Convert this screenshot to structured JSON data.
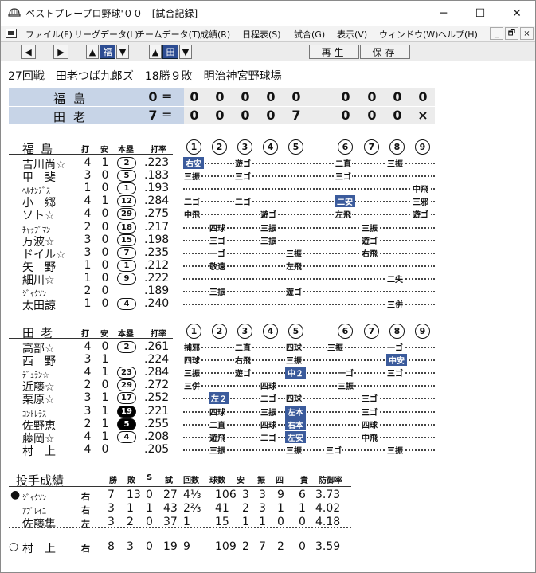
{
  "window": {
    "title": "ベストプレープロ野球'００ - [試合記録]",
    "min": "─",
    "max": "☐",
    "close": "✕"
  },
  "menu": [
    "ファイル(F)",
    "リーグデータ(L)",
    "チームデータ(T)",
    "成績(R)",
    "日程表(S)",
    "試合(G)",
    "表示(V)",
    "ウィンドウ(W)",
    "ヘルプ(H)"
  ],
  "mdi": {
    "min": "_",
    "restore": "🗗",
    "close": "×"
  },
  "toolbar": {
    "team1": "福",
    "team2": "田",
    "play": "再生",
    "save": "保存"
  },
  "game": {
    "info": "27回戦　田老つば九郎ズ　18勝９敗　明治神宮野球場"
  },
  "scoreboard": [
    {
      "team": "福島",
      "runs": "0",
      "eq": "=",
      "inn": [
        "0",
        "0",
        "0",
        "0",
        "0",
        "0",
        "0",
        "0",
        "0"
      ]
    },
    {
      "team": "田老",
      "runs": "7",
      "eq": "=",
      "inn": [
        "0",
        "0",
        "0",
        "0",
        "7",
        "0",
        "0",
        "0",
        "×"
      ]
    }
  ],
  "col_headers": {
    "ab": "打",
    "h": "安",
    "hr": "本塁",
    "avg": "打率"
  },
  "innings": [
    "1",
    "2",
    "3",
    "4",
    "5",
    "6",
    "7",
    "8",
    "9"
  ],
  "away": {
    "team": "福島",
    "players": [
      {
        "name": "吉川尚☆",
        "ab": "4",
        "h": "1",
        "hr": "2",
        "avg": ".223"
      },
      {
        "name": "甲　斐",
        "ab": "3",
        "h": "0",
        "hr": "5",
        "avg": ".183"
      },
      {
        "name": "ﾍﾙﾅﾝﾃﾞｽ",
        "ab": "1",
        "h": "0",
        "hr": "1",
        "avg": ".193"
      },
      {
        "name": "小　郷",
        "ab": "4",
        "h": "1",
        "hr": "12",
        "avg": ".284"
      },
      {
        "name": "ソト☆",
        "ab": "4",
        "h": "0",
        "hr": "29",
        "avg": ".275"
      },
      {
        "name": "ﾁｬｯﾌﾟﾏﾝ",
        "ab": "2",
        "h": "0",
        "hr": "18",
        "avg": ".217"
      },
      {
        "name": "万波☆",
        "ab": "3",
        "h": "0",
        "hr": "15",
        "avg": ".198"
      },
      {
        "name": "ドイル☆",
        "ab": "3",
        "h": "0",
        "hr": "7",
        "avg": ".235"
      },
      {
        "name": "矢　野",
        "ab": "1",
        "h": "0",
        "hr": "1",
        "avg": ".212"
      },
      {
        "name": "細川☆",
        "ab": "1",
        "h": "0",
        "hr": "9",
        "avg": ".222"
      },
      {
        "name": "ｼﾞｬｸｿﾝ",
        "ab": "2",
        "h": "0",
        "hr": "",
        "avg": ".189"
      },
      {
        "name": "太田諒",
        "ab": "1",
        "h": "0",
        "hr": "4",
        "avg": ".240"
      }
    ]
  },
  "home": {
    "team": "田老",
    "players": [
      {
        "name": "高部☆",
        "ab": "4",
        "h": "0",
        "hr": "2",
        "avg": ".261"
      },
      {
        "name": "西　野",
        "ab": "3",
        "h": "1",
        "hr": "",
        "avg": ".224"
      },
      {
        "name": "ﾃﾞｭﾗﾝ☆",
        "ab": "4",
        "h": "1",
        "hr": "23",
        "avg": ".284"
      },
      {
        "name": "近藤☆",
        "ab": "2",
        "h": "0",
        "hr": "29",
        "avg": ".272"
      },
      {
        "name": "栗原☆",
        "ab": "3",
        "h": "1",
        "hr": "17",
        "avg": ".252"
      },
      {
        "name": "ｺﾝﾄﾚﾗｽ",
        "ab": "3",
        "h": "1",
        "hr": "19",
        "avg": ".221"
      },
      {
        "name": "佐野恵",
        "ab": "2",
        "h": "1",
        "hr": "5",
        "avg": ".255"
      },
      {
        "name": "藤岡☆",
        "ab": "4",
        "h": "1",
        "hr": "4",
        "avg": ".208"
      },
      {
        "name": "村　上",
        "ab": "4",
        "h": "0",
        "hr": "",
        "avg": ".205"
      }
    ]
  },
  "pitching": {
    "title": "投手成績",
    "headers": [
      "勝",
      "敗",
      "S",
      "試",
      "回数",
      "球数",
      "安",
      "振",
      "四",
      "責",
      "防御率"
    ],
    "rows": [
      {
        "mark": "●",
        "name": "ｼﾞｬｸｿﾝ",
        "hand": "右",
        "w": "7",
        "l": "13",
        "s": "0",
        "g": "27",
        "ip": "4⅓",
        "np": "106",
        "h": "3",
        "k": "3",
        "bb": "9",
        "er": "6",
        "era": "3.73"
      },
      {
        "mark": "",
        "name": "ｱﾌﾞﾚｲﾕ",
        "hand": "右",
        "w": "3",
        "l": "1",
        "s": "1",
        "g": "43",
        "ip": "2⅔",
        "np": "41",
        "h": "2",
        "k": "3",
        "bb": "1",
        "er": "1",
        "era": "4.02"
      },
      {
        "mark": "",
        "name": "佐藤隼",
        "hand": "左",
        "w": "3",
        "l": "2",
        "s": "0",
        "g": "37",
        "ip": "1",
        "np": "15",
        "h": "1",
        "k": "1",
        "bb": "0",
        "er": "0",
        "era": "4.18"
      },
      {
        "mark": "○",
        "name": "村　上",
        "hand": "右",
        "w": "8",
        "l": "3",
        "s": "0",
        "g": "19",
        "ip": "9",
        "np": "109",
        "h": "2",
        "k": "7",
        "bb": "2",
        "er": "0",
        "era": "3.59"
      }
    ]
  },
  "colors": {
    "accent": "#3b5b9c",
    "score_name_bg": "#c7d4e7",
    "score_inn_bg": "#ececec"
  }
}
